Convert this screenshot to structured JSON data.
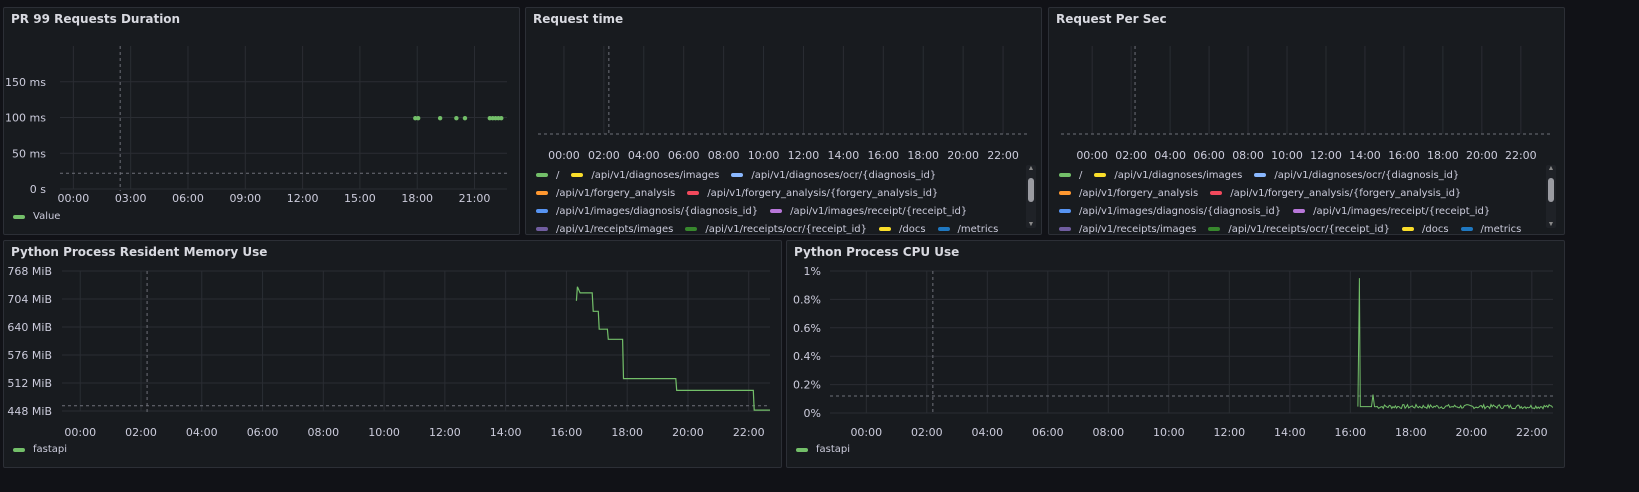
{
  "panels": {
    "pr99": {
      "title": "PR 99 Requests Duration",
      "legend": [
        {
          "label": "Value",
          "color": "#73bf69"
        }
      ]
    },
    "reqtime": {
      "title": "Request time",
      "legend_rows": [
        [
          {
            "label": "/",
            "color": "#73bf69"
          },
          {
            "label": "/api/v1/diagnoses/images",
            "color": "#fade2a"
          },
          {
            "label": "/api/v1/diagnoses/ocr/{diagnosis_id}",
            "color": "#8ab8ff"
          }
        ],
        [
          {
            "label": "/api/v1/forgery_analysis",
            "color": "#ff9830"
          },
          {
            "label": "/api/v1/forgery_analysis/{forgery_analysis_id}",
            "color": "#f2495c"
          }
        ],
        [
          {
            "label": "/api/v1/images/diagnosis/{diagnosis_id}",
            "color": "#5794f2"
          },
          {
            "label": "/api/v1/images/receipt/{receipt_id}",
            "color": "#b877d9"
          }
        ],
        [
          {
            "label": "/api/v1/receipts/images",
            "color": "#705da0"
          },
          {
            "label": "/api/v1/receipts/ocr/{receipt_id}",
            "color": "#37872d"
          },
          {
            "label": "/docs",
            "color": "#fade2a"
          },
          {
            "label": "/metrics",
            "color": "#1f78c1"
          }
        ]
      ]
    },
    "reqsec": {
      "title": "Request Per Sec",
      "legend_rows": [
        [
          {
            "label": "/",
            "color": "#73bf69"
          },
          {
            "label": "/api/v1/diagnoses/images",
            "color": "#fade2a"
          },
          {
            "label": "/api/v1/diagnoses/ocr/{diagnosis_id}",
            "color": "#8ab8ff"
          }
        ],
        [
          {
            "label": "/api/v1/forgery_analysis",
            "color": "#ff9830"
          },
          {
            "label": "/api/v1/forgery_analysis/{forgery_analysis_id}",
            "color": "#f2495c"
          }
        ],
        [
          {
            "label": "/api/v1/images/diagnosis/{diagnosis_id}",
            "color": "#5794f2"
          },
          {
            "label": "/api/v1/images/receipt/{receipt_id}",
            "color": "#b877d9"
          }
        ],
        [
          {
            "label": "/api/v1/receipts/images",
            "color": "#705da0"
          },
          {
            "label": "/api/v1/receipts/ocr/{receipt_id}",
            "color": "#37872d"
          },
          {
            "label": "/docs",
            "color": "#fade2a"
          },
          {
            "label": "/metrics",
            "color": "#1f78c1"
          }
        ]
      ]
    },
    "memory": {
      "title": "Python Process Resident Memory Use",
      "legend": [
        {
          "label": "fastapi",
          "color": "#73bf69"
        }
      ]
    },
    "cpu": {
      "title": "Python Process CPU Use",
      "legend": [
        {
          "label": "fastapi",
          "color": "#73bf69"
        }
      ]
    }
  },
  "chart_data": [
    {
      "id": "pr99",
      "type": "scatter",
      "title": "PR 99 Requests Duration",
      "x_ticks": [
        "00:00",
        "03:00",
        "06:00",
        "09:00",
        "12:00",
        "15:00",
        "18:00",
        "21:00"
      ],
      "y_ticks": [
        "0 s",
        "50 ms",
        "100 ms",
        "150 ms"
      ],
      "ylim": [
        0,
        200
      ],
      "xlim_hours": [
        -0.7,
        22.7
      ],
      "threshold_ms": 22,
      "now_marker_hour": 2.45,
      "series": [
        {
          "name": "Value",
          "color": "#73bf69",
          "points": [
            [
              17.9,
              99
            ],
            [
              18.05,
              99
            ],
            [
              19.2,
              99
            ],
            [
              20.05,
              99
            ],
            [
              20.5,
              99
            ],
            [
              21.8,
              99
            ],
            [
              21.95,
              99
            ],
            [
              22.1,
              99
            ],
            [
              22.25,
              99
            ],
            [
              22.4,
              99
            ]
          ]
        }
      ]
    },
    {
      "id": "reqtime",
      "type": "line",
      "title": "Request time",
      "x_ticks": [
        "00:00",
        "02:00",
        "04:00",
        "06:00",
        "08:00",
        "10:00",
        "12:00",
        "14:00",
        "16:00",
        "18:00",
        "20:00",
        "22:00"
      ],
      "xlim_hours": [
        -1.3,
        23.3
      ],
      "now_marker_hour": 2.25,
      "grid": true
    },
    {
      "id": "reqsec",
      "type": "line",
      "title": "Request Per Sec",
      "x_ticks": [
        "00:00",
        "02:00",
        "04:00",
        "06:00",
        "08:00",
        "10:00",
        "12:00",
        "14:00",
        "16:00",
        "18:00",
        "20:00",
        "22:00"
      ],
      "xlim_hours": [
        -1.6,
        23.6
      ],
      "now_marker_hour": 2.2,
      "grid": true
    },
    {
      "id": "memory",
      "type": "line",
      "title": "Python Process Resident Memory Use",
      "x_ticks": [
        "00:00",
        "02:00",
        "04:00",
        "06:00",
        "08:00",
        "10:00",
        "12:00",
        "14:00",
        "16:00",
        "18:00",
        "20:00",
        "22:00"
      ],
      "y_ticks": [
        "448 MiB",
        "512 MiB",
        "576 MiB",
        "640 MiB",
        "704 MiB",
        "768 MiB"
      ],
      "ylim_mib": [
        448,
        768
      ],
      "xlim_hours": [
        -0.6,
        22.7
      ],
      "now_marker_hour": 2.2,
      "threshold_mib": 460,
      "series": [
        {
          "name": "fastapi",
          "color": "#73bf69",
          "points": [
            [
              16.33,
              700
            ],
            [
              16.36,
              732
            ],
            [
              16.45,
              718
            ],
            [
              16.85,
              718
            ],
            [
              16.88,
              676
            ],
            [
              17.05,
              676
            ],
            [
              17.08,
              635
            ],
            [
              17.35,
              635
            ],
            [
              17.38,
              612
            ],
            [
              17.85,
              612
            ],
            [
              17.88,
              522
            ],
            [
              19.6,
              522
            ],
            [
              19.63,
              495
            ],
            [
              22.15,
              495
            ],
            [
              22.18,
              450
            ],
            [
              22.7,
              450
            ]
          ]
        }
      ]
    },
    {
      "id": "cpu",
      "type": "line",
      "title": "Python Process CPU Use",
      "x_ticks": [
        "00:00",
        "02:00",
        "04:00",
        "06:00",
        "08:00",
        "10:00",
        "12:00",
        "14:00",
        "16:00",
        "18:00",
        "20:00",
        "22:00"
      ],
      "y_ticks": [
        "0%",
        "0.2%",
        "0.4%",
        "0.6%",
        "0.8%",
        "1%"
      ],
      "ylim_pct": [
        0,
        1.0
      ],
      "xlim_hours": [
        -1.2,
        22.7
      ],
      "now_marker_hour": 2.2,
      "threshold_pct": 0.12,
      "series": [
        {
          "name": "fastapi",
          "color": "#73bf69",
          "spike_hour": 16.3,
          "spike_pct": 0.95,
          "baseline_pct": 0.045,
          "noise_pct": 0.015,
          "start_hour": 16.25,
          "end_hour": 22.7
        }
      ]
    }
  ]
}
